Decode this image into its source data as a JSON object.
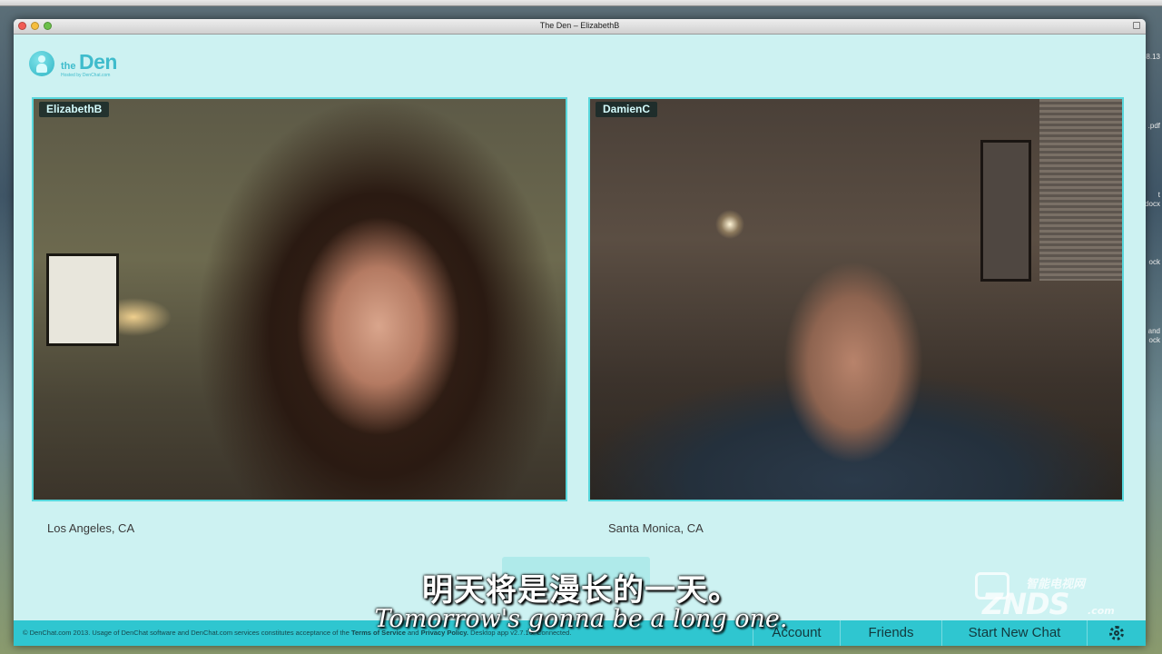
{
  "window": {
    "title": "The Den – ElizabethB"
  },
  "logo": {
    "the": "the",
    "den": "Den",
    "sub": "Hosted by DenChat.com"
  },
  "chat": {
    "left": {
      "name": "ElizabethB",
      "location": "Los Angeles, CA"
    },
    "right": {
      "name": "DamienC",
      "location": "Santa Monica, CA"
    }
  },
  "footer": {
    "copyright_prefix": "© DenChat.com 2013. Usage of DenChat software and DenChat.com services constitutes acceptance of the",
    "terms": "Terms of Service",
    "and": "and",
    "privacy": "Privacy Policy.",
    "version": "Desktop app v2.7.16.",
    "status": "Connected.",
    "account": "Account",
    "friends": "Friends",
    "start_new_chat": "Start New Chat",
    "settings_icon": "gear-icon"
  },
  "subtitles": {
    "chinese": "明天将是漫长的一天。",
    "english": "Tomorrow's gonna be a long one."
  },
  "watermark": {
    "cn": "智能电视网",
    "logo": "ZNDS",
    "suffix": ".com"
  },
  "colors": {
    "accent": "#2fc6d0",
    "window_bg": "#cdf2f2",
    "video_border": "#58d7dc"
  }
}
